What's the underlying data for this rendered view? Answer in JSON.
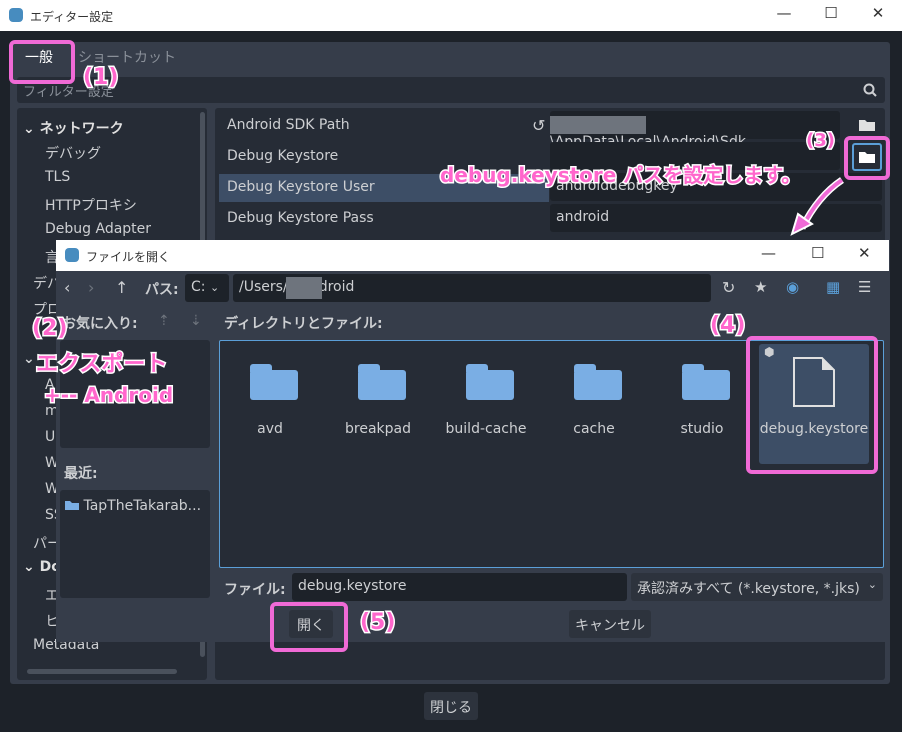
{
  "window": {
    "title": "エディター設定",
    "minimize": "—",
    "maximize": "☐",
    "close": "✕"
  },
  "tabs": [
    "一般",
    "ショートカット"
  ],
  "filter": {
    "placeholder": "フィルター設定"
  },
  "tree": {
    "section1": "ネットワーク",
    "items1": [
      "デバッグ",
      "TLS",
      "HTTPプロキシ",
      "Debug Adapter",
      "言"
    ],
    "partial": [
      "デバ",
      "プロ"
    ],
    "sub": [
      "A",
      "m",
      "U",
      "W",
      "W",
      "SS"
    ],
    "partial2": "パー",
    "section2": "Dot",
    "items2": [
      "エ",
      "ヒ"
    ],
    "metadata": "Metadata"
  },
  "settings": {
    "rows": [
      {
        "label": "Android SDK Path",
        "value": "\\AppData\\Local\\Android\\Sdk"
      },
      {
        "label": "Debug Keystore",
        "value": ""
      },
      {
        "label": "Debug Keystore User",
        "value": "androiddebugkey"
      },
      {
        "label": "Debug Keystore Pass",
        "value": "android"
      }
    ]
  },
  "close_button": "閉じる",
  "annotations": {
    "a1": "(1)",
    "a2": "(2)",
    "a2_line1": "エクスポート",
    "a2_line2": "+-- Android",
    "a3": "(3)",
    "a3_text": "debug.keystore パスを設定します。",
    "a4": "(4)",
    "a5": "(5)"
  },
  "dialog": {
    "title": "ファイルを開く",
    "path_label": "パス:",
    "drive": "C:",
    "path": "/Users/     /.android",
    "favorites_label": "お気に入り:",
    "recent_label": "最近:",
    "recent_items": [
      "TapTheTakarab..."
    ],
    "files_label": "ディレクトリとファイル:",
    "folders": [
      "avd",
      "breakpad",
      "build-cache",
      "cache",
      "studio"
    ],
    "selected_file": "debug.keystore",
    "file_label": "ファイル:",
    "file_value": "debug.keystore",
    "filter": "承認済みすべて (*.keystore, *.jks)",
    "open_button": "開く",
    "cancel_button": "キャンセル"
  },
  "colors": {
    "accent": "#5b9fd8",
    "annotation": "#f06ad6",
    "folder": "#7aaee4"
  }
}
